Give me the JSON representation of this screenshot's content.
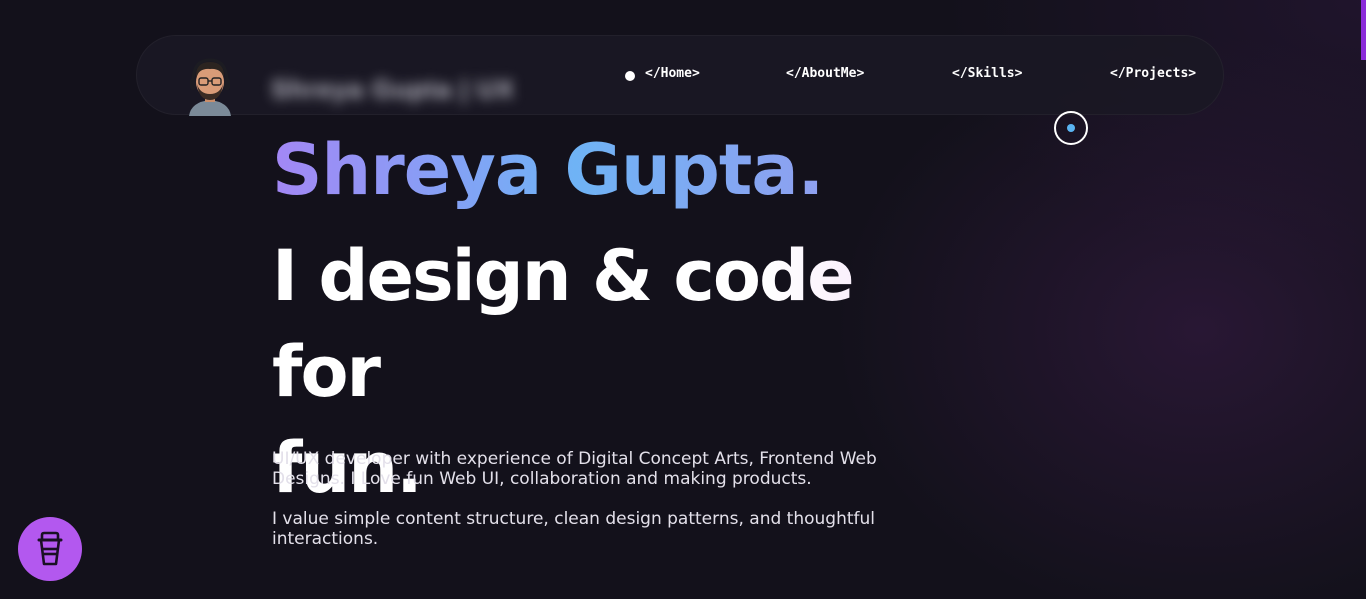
{
  "header": {
    "brand_name": "Shreya Gupta | UX",
    "nav": [
      {
        "label": "</Home>",
        "active": true
      },
      {
        "label": "</AboutMe>",
        "active": false
      },
      {
        "label": "</Skills>",
        "active": false
      },
      {
        "label": "</Projects>",
        "active": false
      }
    ]
  },
  "hero": {
    "name": "Shreya Gupta.",
    "headline_line1": "I design & code for",
    "headline_line2": "fun.",
    "paragraph_1": "UI/UX developer with experience of Digital Concept Arts, Frontend Web Designs. I Love fun Web UI, collaboration and making products.",
    "paragraph_2": "I value simple content structure, clean design patterns, and thoughtful interactions."
  },
  "icons": {
    "avatar": "memoji-avatar-with-headphones",
    "floating_button": "coffee-cup-icon",
    "cursor": "cursor-ring"
  },
  "colors": {
    "background": "#13111b",
    "navbar": "#1a1824",
    "name_gradient_start": "#a387f5",
    "name_gradient_mid": "#6fb3f5",
    "accent_purple": "#b358ef",
    "cursor_dot": "#5ab4f2"
  }
}
